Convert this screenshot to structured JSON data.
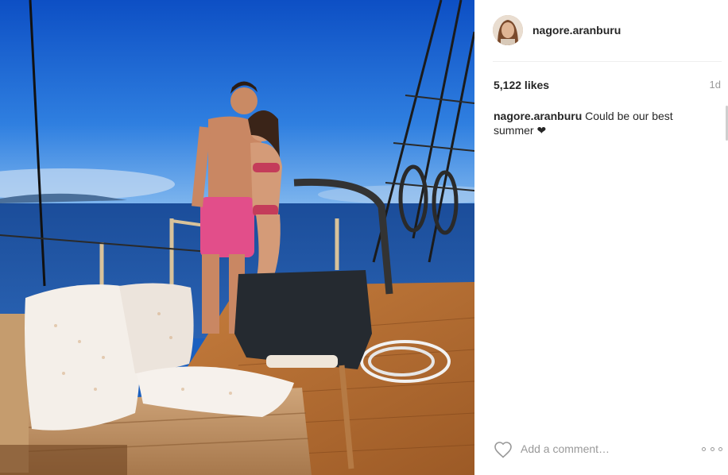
{
  "post": {
    "username": "nagore.aranburu",
    "likes": "5,122 likes",
    "time": "1d",
    "caption": {
      "username": "nagore.aranburu",
      "text": "Could be our best summer ❤"
    }
  },
  "comment": {
    "placeholder": "Add a comment…"
  },
  "icons": {
    "like": "heart-outline-icon",
    "more": "more-options-icon"
  },
  "colors": {
    "text": "#262626",
    "muted": "#999999",
    "divider": "#efefef"
  }
}
